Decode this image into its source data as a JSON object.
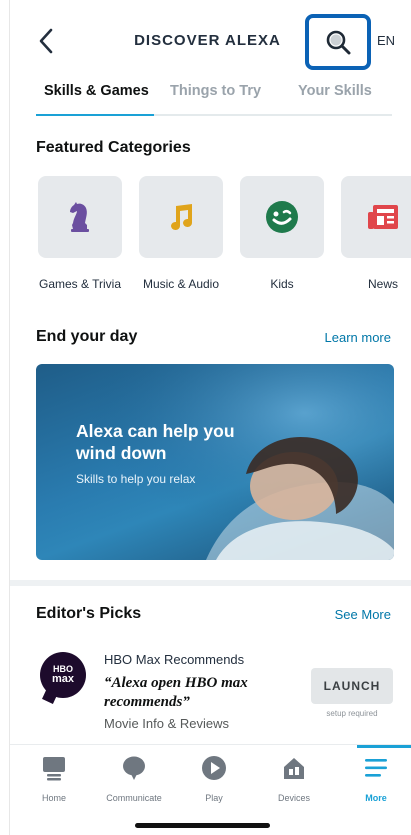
{
  "header": {
    "title": "DISCOVER ALEXA",
    "language": "EN",
    "accent_color": "#0b62b5"
  },
  "tabs": [
    {
      "label": "Skills & Games",
      "active": true
    },
    {
      "label": "Things to Try",
      "active": false
    },
    {
      "label": "Your Skills",
      "active": false
    }
  ],
  "featured": {
    "title": "Featured Categories",
    "categories": [
      {
        "label": "Games & Trivia",
        "icon": "chess-knight-icon",
        "color": "#6b4fa0"
      },
      {
        "label": "Music & Audio",
        "icon": "music-note-icon",
        "color": "#e0a41b"
      },
      {
        "label": "Kids",
        "icon": "smiley-icon",
        "color": "#1f7a4c"
      },
      {
        "label": "News",
        "icon": "newspaper-icon",
        "color": "#e0464b"
      }
    ]
  },
  "end_day": {
    "title": "End your day",
    "link": "Learn more",
    "banner_heading": "Alexa can help you wind down",
    "banner_sub": "Skills to help you relax"
  },
  "editors_picks": {
    "title": "Editor's Picks",
    "link": "See More",
    "item": {
      "logo_line1": "HBO",
      "logo_line2": "max",
      "name": "HBO Max Recommends",
      "quote": "“Alexa open HBO max recommends”",
      "category": "Movie Info & Reviews",
      "button": "LAUNCH",
      "button_note": "setup required"
    }
  },
  "nav": {
    "items": [
      {
        "label": "Home",
        "icon": "home-icon",
        "active": false
      },
      {
        "label": "Communicate",
        "icon": "chat-bubble-icon",
        "active": false
      },
      {
        "label": "Play",
        "icon": "play-icon",
        "active": false
      },
      {
        "label": "Devices",
        "icon": "devices-house-icon",
        "active": false
      },
      {
        "label": "More",
        "icon": "menu-lines-icon",
        "active": true
      }
    ],
    "active_color": "#1aa1d6"
  }
}
